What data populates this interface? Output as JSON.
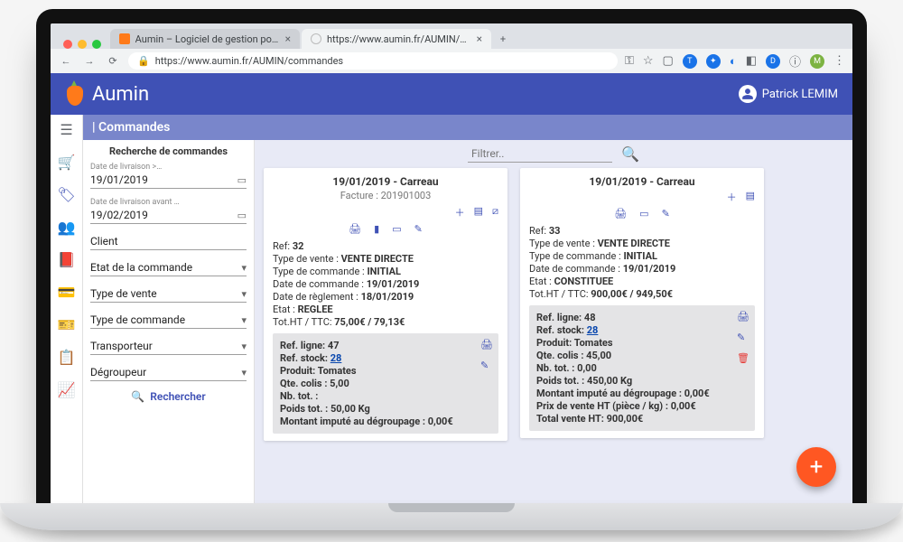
{
  "browser": {
    "tabs": [
      {
        "title": "Aumin – Logiciel de gestion pou…",
        "active": false
      },
      {
        "title": "https://www.aumin.fr/AUMIN/c…",
        "active": true
      }
    ],
    "url": "https://www.aumin.fr/AUMIN/commandes"
  },
  "app": {
    "brand": "Aumin",
    "user": "Patrick LEMIM",
    "page_title": "| Commandes"
  },
  "sidebar_icons": [
    "menu",
    "cart",
    "tag",
    "group",
    "book",
    "card",
    "ticket",
    "clipboard",
    "chart"
  ],
  "search": {
    "heading": "Recherche de commandes",
    "date_from": {
      "label": "Date de livraison >…",
      "value": "19/01/2019"
    },
    "date_to": {
      "label": "Date de livraison avant …",
      "value": "19/02/2019"
    },
    "fields": {
      "client": "Client",
      "etat": "Etat de la commande",
      "type_vente": "Type de vente",
      "type_commande": "Type de commande",
      "transporteur": "Transporteur",
      "degroupeur": "Dégroupeur"
    },
    "button": "Rechercher"
  },
  "filter_placeholder": "Filtrer..",
  "cards": [
    {
      "title": "19/01/2019 - Carreau",
      "subtitle": "Facture : 201901003",
      "ref": "32",
      "type_vente": "VENTE DIRECTE",
      "type_commande": "INITIAL",
      "date_commande": "19/01/2019",
      "date_reglement": "18/01/2019",
      "etat": "REGLEE",
      "tot": "75,00€ / 79,13€",
      "line": {
        "ref_ligne": "47",
        "ref_stock": "28",
        "produit": "Tomates",
        "qte_colis": "5,00",
        "nb_tot": "",
        "poids_tot": "50,00 Kg",
        "montant_degroupage": "0,00€"
      }
    },
    {
      "title": "19/01/2019 - Carreau",
      "subtitle": "",
      "ref": "33",
      "type_vente": "VENTE DIRECTE",
      "type_commande": "INITIAL",
      "date_commande": "19/01/2019",
      "etat": "CONSTITUEE",
      "tot": "900,00€ / 949,50€",
      "line": {
        "ref_ligne": "48",
        "ref_stock": "28",
        "produit": "Tomates",
        "qte_colis": "45,00",
        "nb_tot": "0,00",
        "poids_tot": "450,00 Kg",
        "montant_degroupage": "0,00€",
        "prix_vente_ht": "0,00€",
        "total_vente_ht": "900,00€"
      }
    }
  ],
  "labels": {
    "ref": "Ref:",
    "type_vente": "Type de vente :",
    "type_commande": "Type de commande :",
    "date_commande": "Date de commande :",
    "date_reglement": "Date de règlement :",
    "etat": "Etat :",
    "tot": "Tot.HT / TTC:",
    "ref_ligne": "Ref. ligne:",
    "ref_stock": "Ref. stock:",
    "produit": "Produit:",
    "qte_colis": "Qte. colis :",
    "nb_tot": "Nb. tot. :",
    "poids_tot": "Poids tot. :",
    "montant_degroupage": "Montant imputé au dégroupage :",
    "prix_vente_ht": "Prix de vente HT (pièce / kg) :",
    "total_vente_ht": "Total vente HT:"
  }
}
